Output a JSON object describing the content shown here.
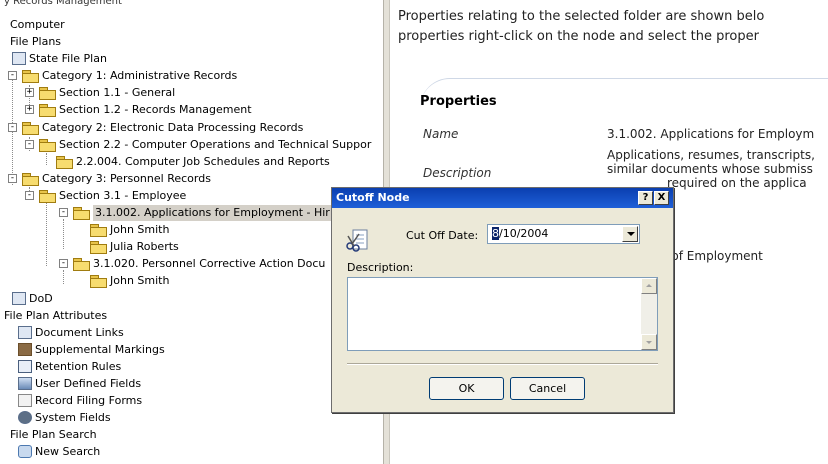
{
  "tree": {
    "header": "y Records Management",
    "items": [
      {
        "label": "Computer",
        "icon": ""
      },
      {
        "label": "File Plans",
        "icon": ""
      },
      {
        "label": "State File Plan",
        "icon": "file-plan-icon"
      },
      {
        "label": "Category 1: Administrative Records",
        "icon": "folder-icon",
        "expander": "minus"
      },
      {
        "label": "Section 1.1 - General",
        "icon": "folder-icon",
        "expander": "plus"
      },
      {
        "label": "Section 1.2 - Records Management",
        "icon": "folder-icon",
        "expander": "plus"
      },
      {
        "label": "Category 2: Electronic Data Processing Records",
        "icon": "folder-icon",
        "expander": "minus"
      },
      {
        "label": "Section 2.2 - Computer Operations and Technical Suppor",
        "icon": "folder-icon",
        "expander": "minus"
      },
      {
        "label": "2.2.004. Computer Job Schedules and Reports",
        "icon": "folder-icon"
      },
      {
        "label": "Category 3: Personnel Records",
        "icon": "folder-icon",
        "expander": "minus"
      },
      {
        "label": "Section 3.1 - Employee",
        "icon": "folder-icon",
        "expander": "minus"
      },
      {
        "label": "3.1.002. Applications for Employment - Hir",
        "icon": "folder-icon",
        "expander": "minus",
        "selected": true
      },
      {
        "label": "John Smith",
        "icon": "folder-icon"
      },
      {
        "label": "Julia Roberts",
        "icon": "folder-icon"
      },
      {
        "label": "3.1.020. Personnel Corrective Action Docu",
        "icon": "folder-icon",
        "expander": "minus"
      },
      {
        "label": "John Smith",
        "icon": "folder-icon"
      },
      {
        "label": "DoD",
        "icon": "file-plan-icon"
      },
      {
        "label": "File Plan Attributes",
        "icon": ""
      },
      {
        "label": "Document Links",
        "icon": "link-icon"
      },
      {
        "label": "Supplemental Markings",
        "icon": "markings-icon"
      },
      {
        "label": "Retention Rules",
        "icon": "calendar-icon"
      },
      {
        "label": "User Defined Fields",
        "icon": "fields-icon"
      },
      {
        "label": "Record Filing Forms",
        "icon": "form-icon"
      },
      {
        "label": "System Fields",
        "icon": "disk-icon"
      },
      {
        "label": "File Plan Search",
        "icon": ""
      },
      {
        "label": "New Search",
        "icon": "search-icon"
      }
    ]
  },
  "details": {
    "intro_line1": "Properties relating to the selected folder are shown belo",
    "intro_line2": "properties right-click on the node and select the proper",
    "heading": "Properties",
    "name_label": "Name",
    "name_value": "3.1.002. Applications for Employm",
    "description_label": "Description",
    "description_line1": "Applications, resumes, transcripts,",
    "description_line2": "similar documents whose submiss",
    "description_line3": "required on the applica",
    "hidden_value": "n of Employment"
  },
  "dialog": {
    "title": "Cutoff Node",
    "help_button": "?",
    "close_button": "X",
    "cutoff_label": "Cut Off Date:",
    "cutoff_value_first": "8",
    "cutoff_value_rest": "/10/2004",
    "description_label": "Description:",
    "description_value": "",
    "ok_label": "OK",
    "cancel_label": "Cancel"
  }
}
